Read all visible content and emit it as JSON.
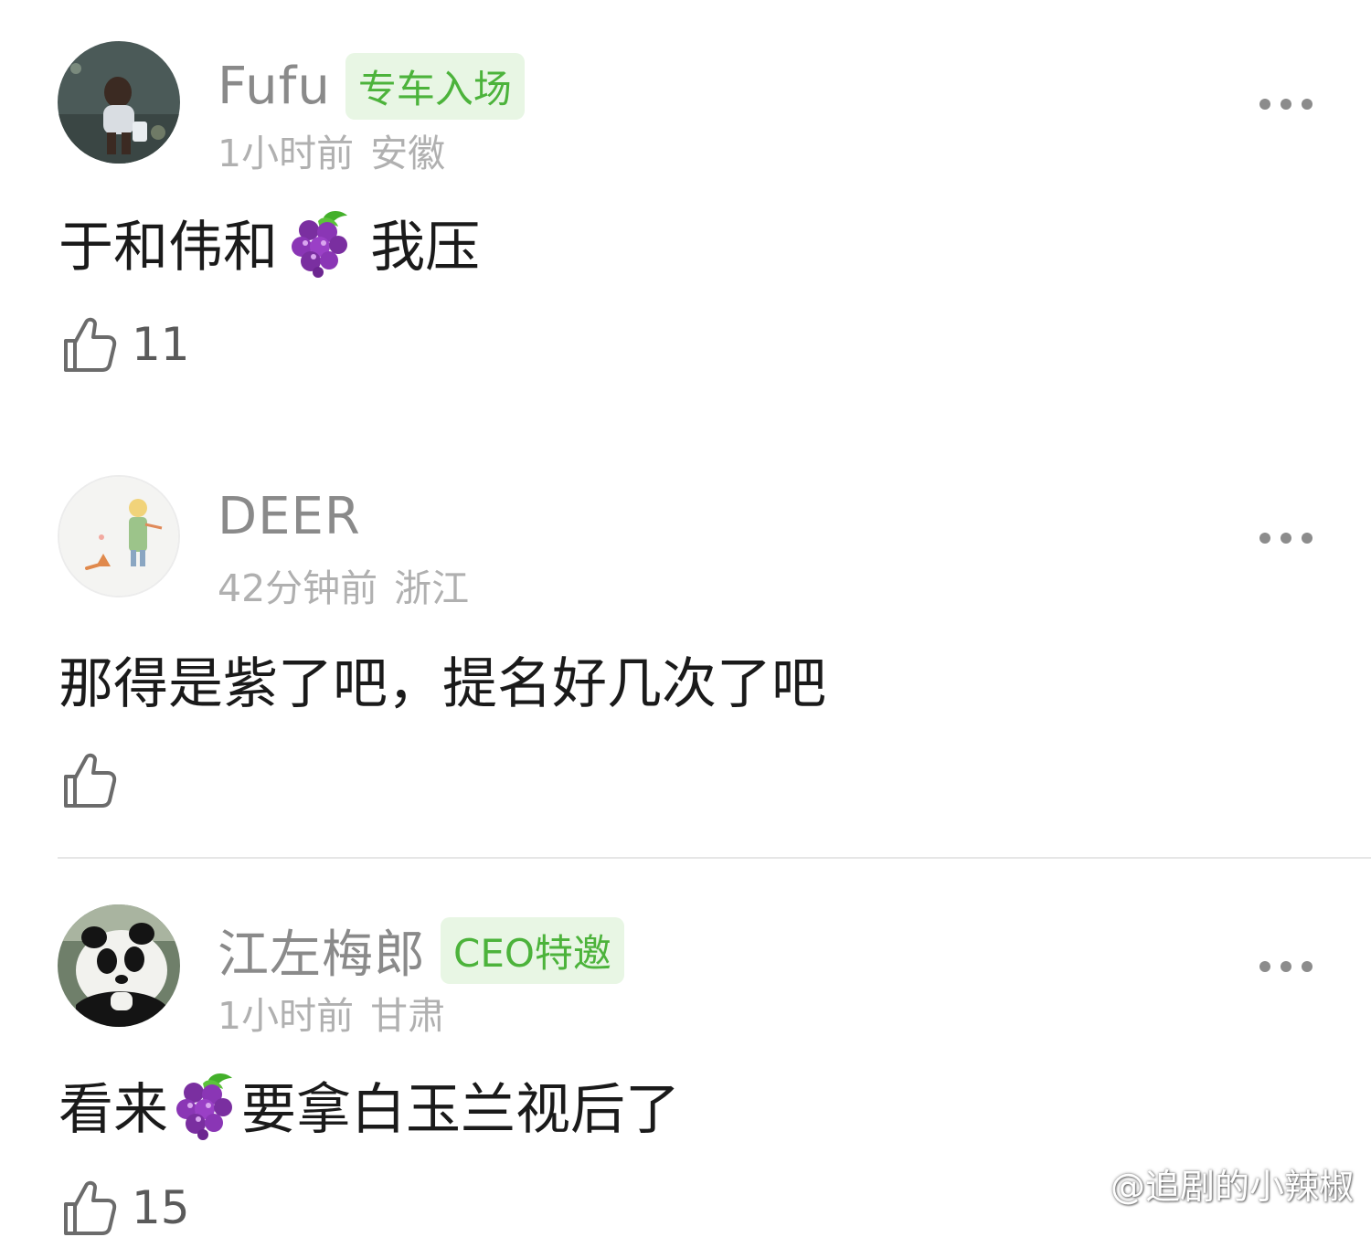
{
  "comments": [
    {
      "username": "Fufu",
      "badge": "专车入场",
      "time": "1小时前",
      "location": "安徽",
      "text_before": "于和伟和",
      "text_after": " 我压",
      "likes": "11"
    },
    {
      "username": "DEER",
      "time": "42分钟前",
      "location": "浙江",
      "text": "那得是紫了吧，提名好几次了吧",
      "likes": ""
    },
    {
      "username": "江左梅郎",
      "badge": "CEO特邀",
      "time": "1小时前",
      "location": "甘肃",
      "text_before": "看来",
      "text_after": "要拿白玉兰视后了",
      "likes": "15"
    }
  ],
  "icons": {
    "more": "more-dots-icon",
    "like": "thumbs-up-icon",
    "emoji": "grapes-emoji-icon",
    "watermark_logo": "weibo-logo-icon"
  },
  "colors": {
    "badge_text": "#4cb33b",
    "badge_bg": "#e8f6e4",
    "username": "#8a8a8a",
    "meta": "#b0b0b0"
  },
  "watermark": "@追剧的小辣椒"
}
